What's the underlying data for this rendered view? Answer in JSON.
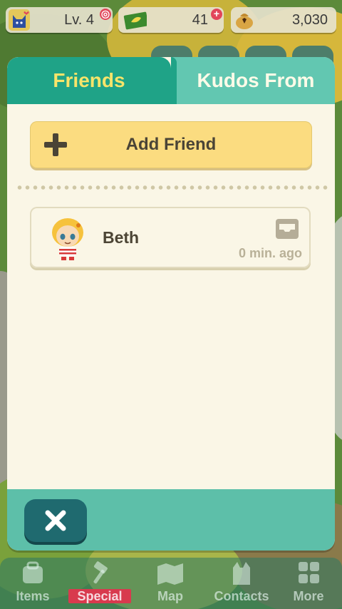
{
  "status": {
    "level": "Lv. 4",
    "tickets": "41",
    "bells": "3,030"
  },
  "tabs": {
    "friends": "Friends",
    "kudos": "Kudos From"
  },
  "add_friend": {
    "label": "Add Friend"
  },
  "friends": [
    {
      "name": "Beth",
      "time": "0 min. ago"
    }
  ],
  "nav": {
    "items": "Items",
    "special": "Special",
    "map": "Map",
    "contacts": "Contacts",
    "more": "More"
  },
  "colors": {
    "tab_active": "#1fa387",
    "tab_inactive": "#62c7b1",
    "button_yellow": "#fbdc80",
    "close_button": "#1f6a6f"
  }
}
